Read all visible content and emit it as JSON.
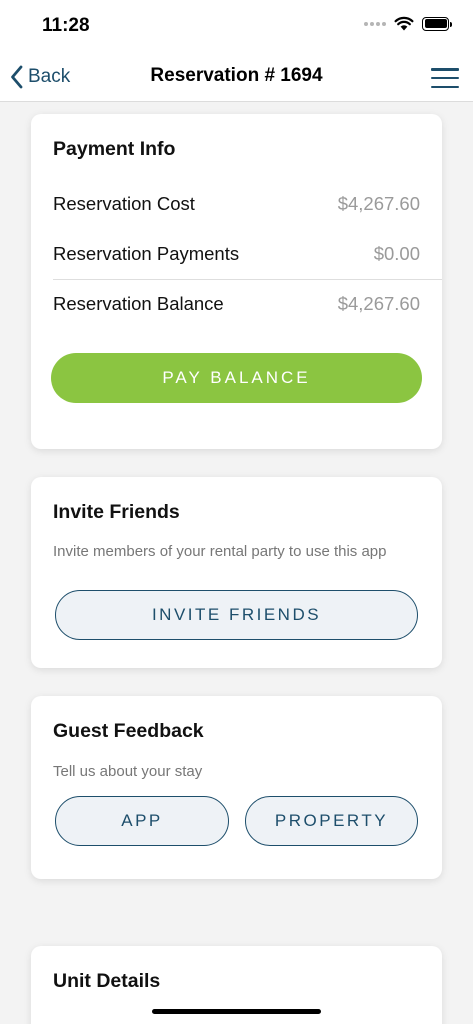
{
  "status_bar": {
    "time": "11:28"
  },
  "nav": {
    "back_label": "Back",
    "title": "Reservation # 1694",
    "accent_color": "#1d4e6b"
  },
  "payment_info": {
    "title": "Payment Info",
    "rows": [
      {
        "label": "Reservation Cost",
        "value": "$4,267.60"
      },
      {
        "label": "Reservation Payments",
        "value": "$0.00"
      },
      {
        "label": "Reservation Balance",
        "value": "$4,267.60"
      }
    ],
    "pay_button_label": "PAY BALANCE",
    "pay_button_color": "#8bc541"
  },
  "invite_friends": {
    "title": "Invite Friends",
    "description": "Invite members of your rental party to use this app",
    "button_label": "INVITE FRIENDS"
  },
  "guest_feedback": {
    "title": "Guest Feedback",
    "description": "Tell us about your stay",
    "app_button_label": "APP",
    "property_button_label": "PROPERTY"
  },
  "unit_details": {
    "title": "Unit Details"
  },
  "icons": {
    "back": "chevron-left-icon",
    "menu": "hamburger-menu-icon",
    "wifi": "wifi-icon",
    "battery": "battery-icon",
    "signal": "cellular-signal-icon"
  }
}
